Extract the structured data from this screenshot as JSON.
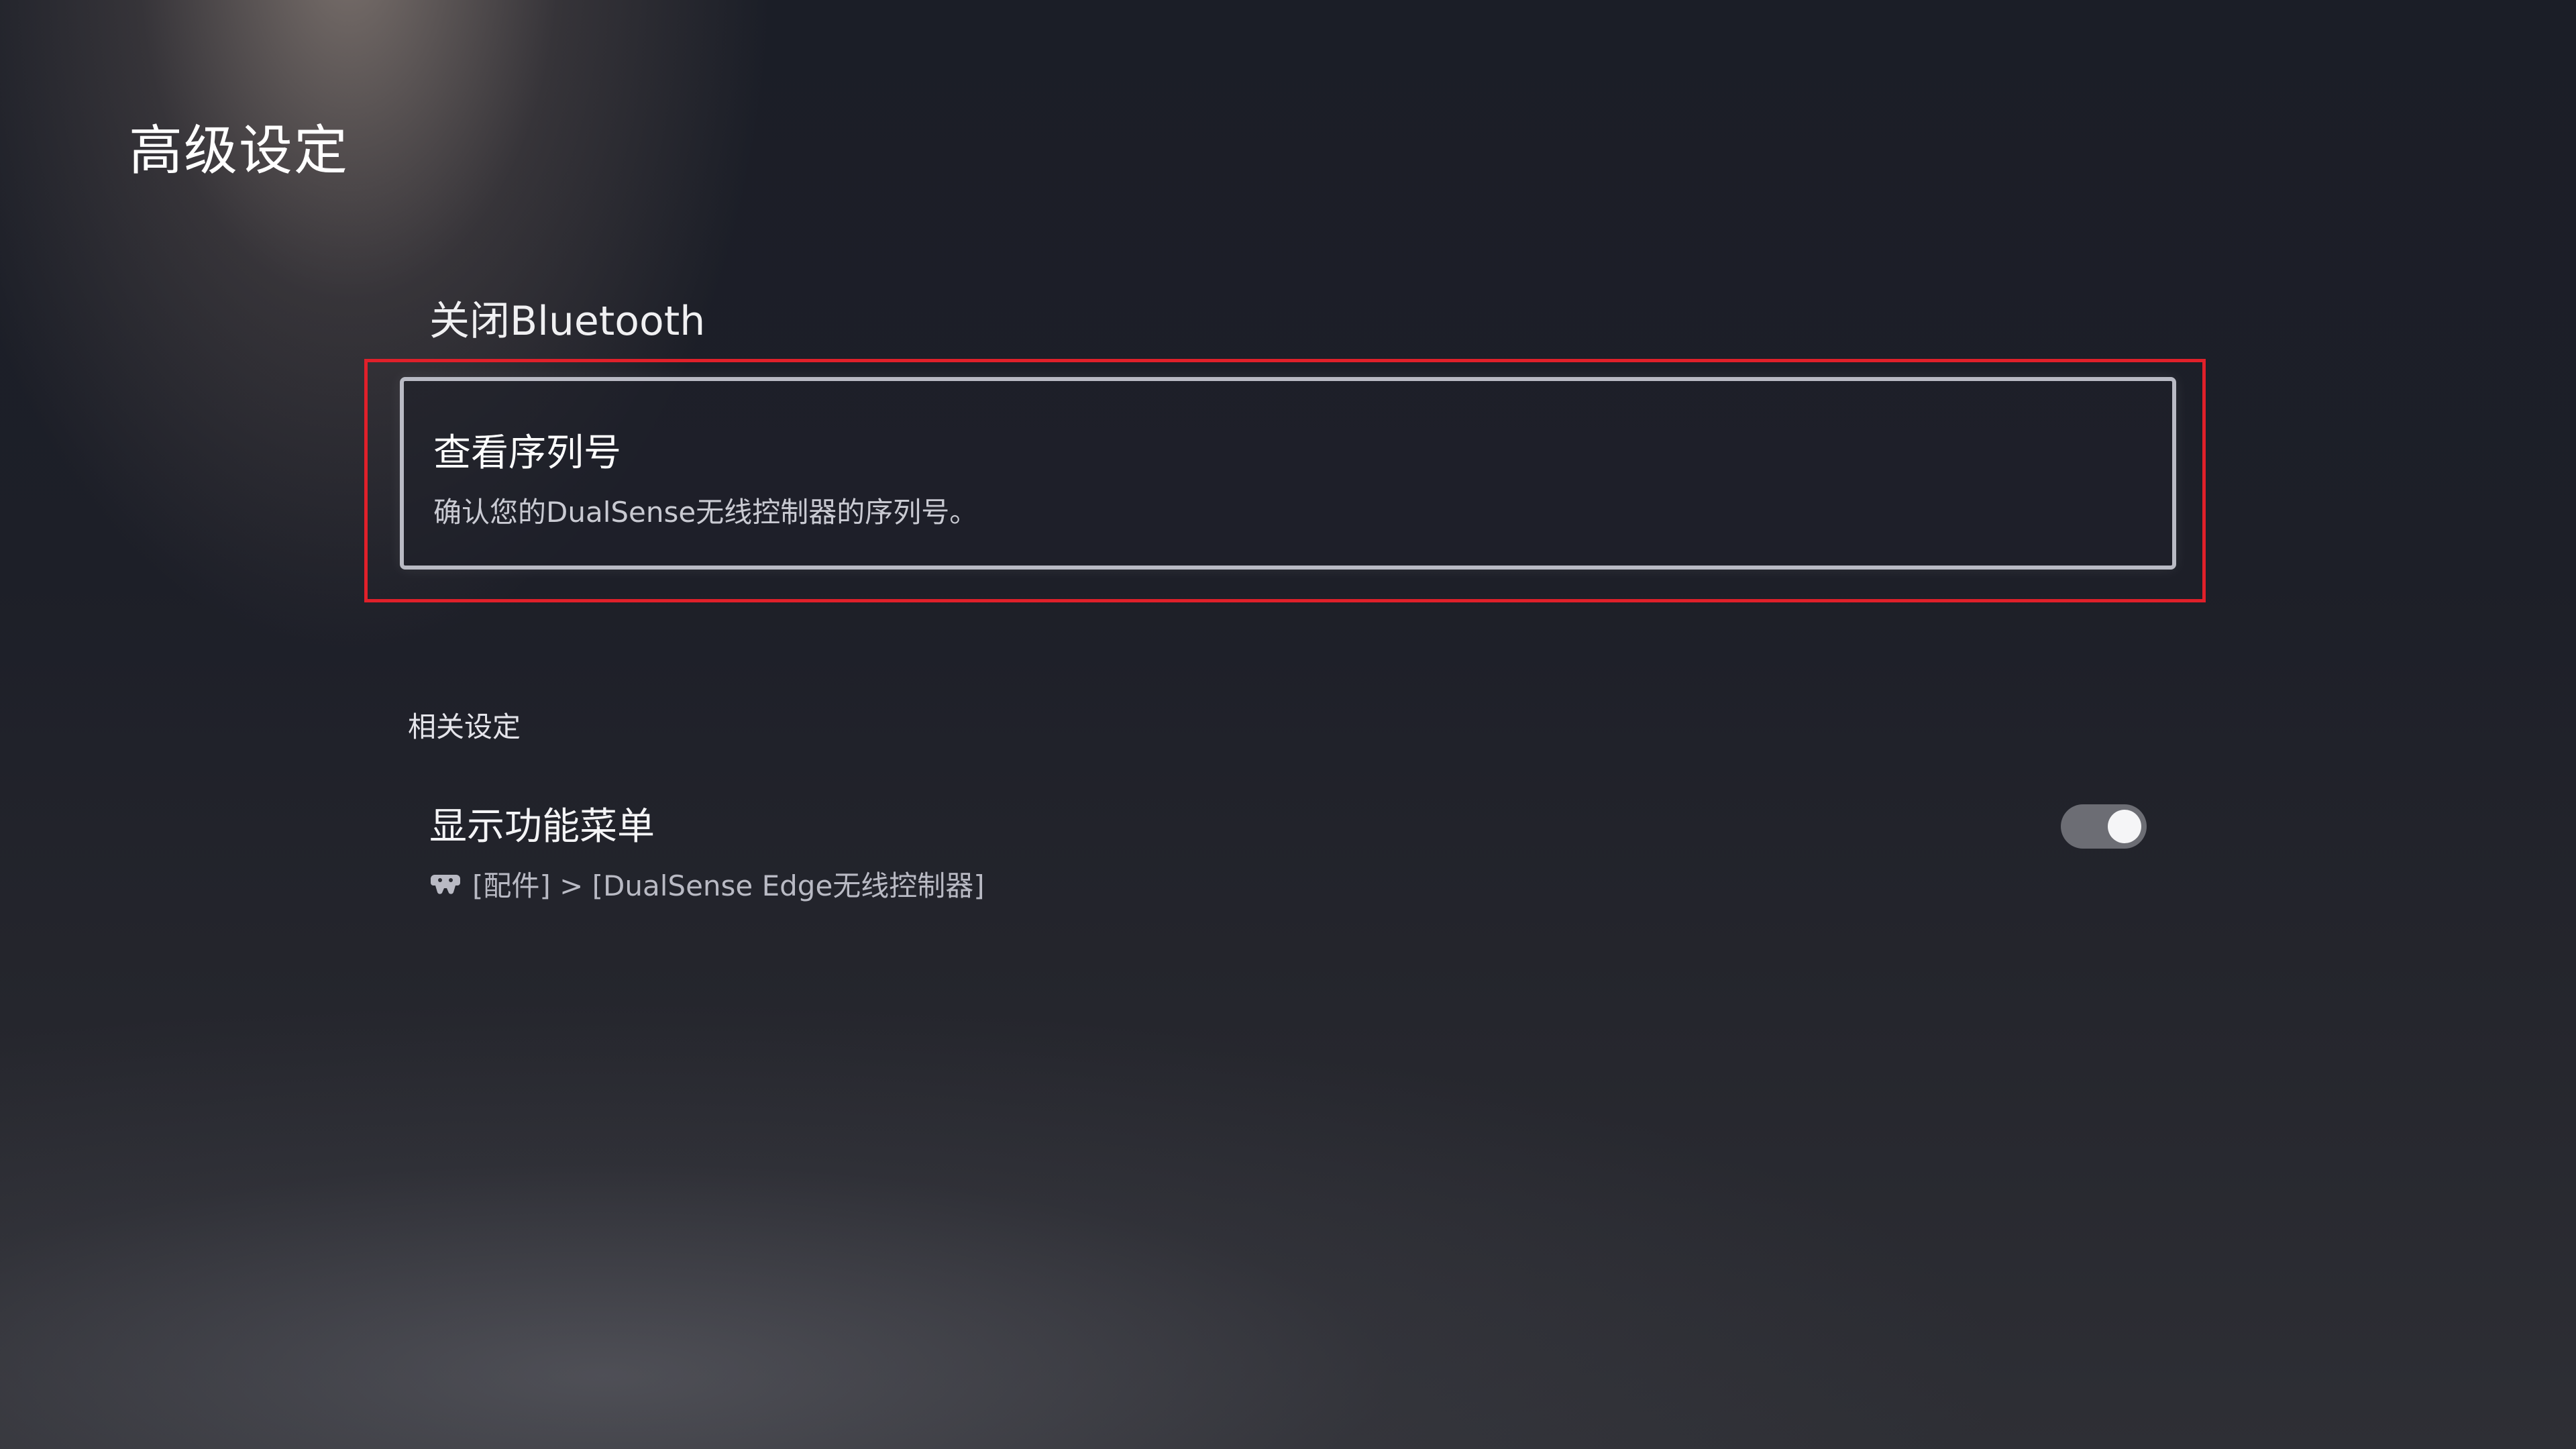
{
  "page": {
    "title": "高级设定"
  },
  "menu": {
    "items": [
      {
        "label": "关闭Bluetooth"
      }
    ],
    "selected": {
      "label": "查看序列号",
      "description": "确认您的DualSense无线控制器的序列号。"
    }
  },
  "related": {
    "header": "相关设定",
    "items": [
      {
        "label": "显示功能菜单",
        "path": "[配件] > [DualSense Edge无线控制器]",
        "path_icon": "controller-icon",
        "toggle_on": true
      }
    ]
  },
  "colors": {
    "highlight_frame": "#e0202a",
    "selection_border": "#b9bac4",
    "toggle_track": "#6c6d74",
    "toggle_knob": "#f5f5f7"
  }
}
